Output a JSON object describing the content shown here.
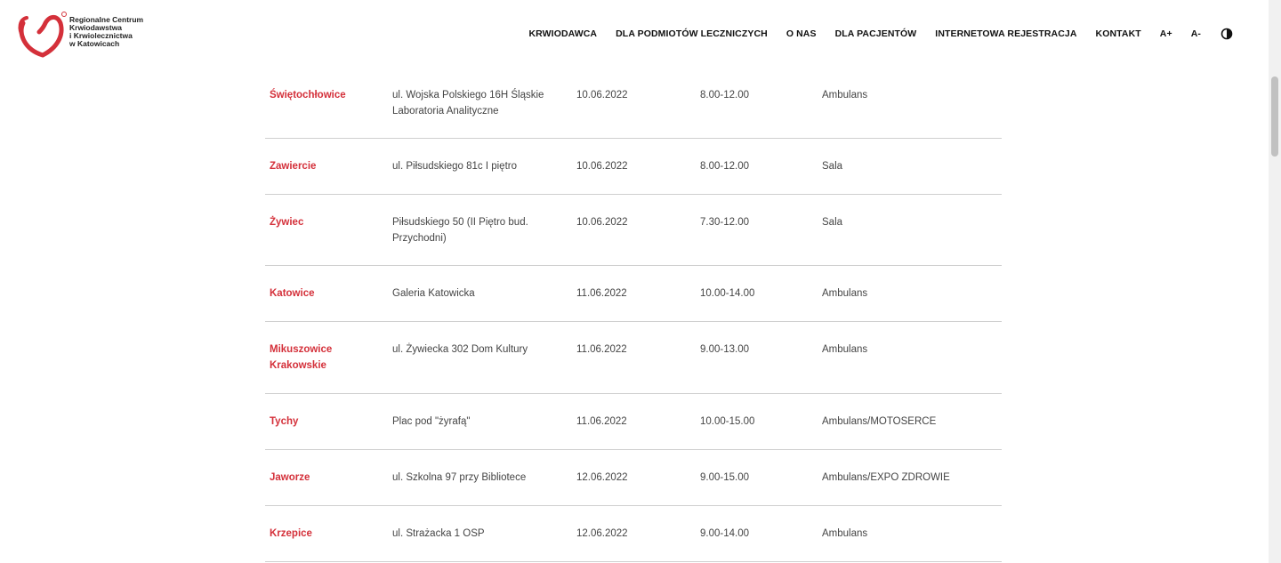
{
  "brand": {
    "name_lines": [
      "Regionalne Centrum",
      "Krwiodawstwa",
      "i Krwiolecznictwa",
      "w Katowicach"
    ],
    "accent_color": "#d4303a",
    "logo_icon": "heart-logo-icon"
  },
  "nav": {
    "items": [
      "KRWIODAWCA",
      "DLA PODMIOTÓW LECZNICZYCH",
      "O NAS",
      "DLA PACJENTÓW",
      "INTERNETOWA REJESTRACJA",
      "KONTAKT",
      "A+",
      "A-"
    ],
    "contrast_icon": "contrast-icon"
  },
  "rows": [
    {
      "city": "Świętochłowice",
      "address": "ul. Wojska Polskiego 16H Śląskie Laboratoria Analityczne",
      "date": "10.06.2022",
      "time": "8.00-12.00",
      "place": "Ambulans"
    },
    {
      "city": "Zawiercie",
      "address": "ul. Piłsudskiego 81c I piętro",
      "date": "10.06.2022",
      "time": "8.00-12.00",
      "place": "Sala"
    },
    {
      "city": "Żywiec",
      "address": "Piłsudskiego 50 (II Piętro bud. Przychodni)",
      "date": "10.06.2022",
      "time": "7.30-12.00",
      "place": "Sala"
    },
    {
      "city": "Katowice",
      "address": "Galeria Katowicka",
      "date": "11.06.2022",
      "time": "10.00-14.00",
      "place": "Ambulans"
    },
    {
      "city": "Mikuszowice Krakowskie",
      "address": "ul. Żywiecka 302 Dom Kultury",
      "date": "11.06.2022",
      "time": "9.00-13.00",
      "place": "Ambulans"
    },
    {
      "city": "Tychy",
      "address": "Plac pod \"żyrafą\"",
      "date": "11.06.2022",
      "time": "10.00-15.00",
      "place": "Ambulans/MOTOSERCE"
    },
    {
      "city": "Jaworze",
      "address": "ul. Szkolna 97 przy Bibliotece",
      "date": "12.06.2022",
      "time": "9.00-15.00",
      "place": "Ambulans/EXPO ZDROWIE"
    },
    {
      "city": "Krzepice",
      "address": "ul. Strażacka 1 OSP",
      "date": "12.06.2022",
      "time": "9.00-14.00",
      "place": "Ambulans"
    }
  ]
}
